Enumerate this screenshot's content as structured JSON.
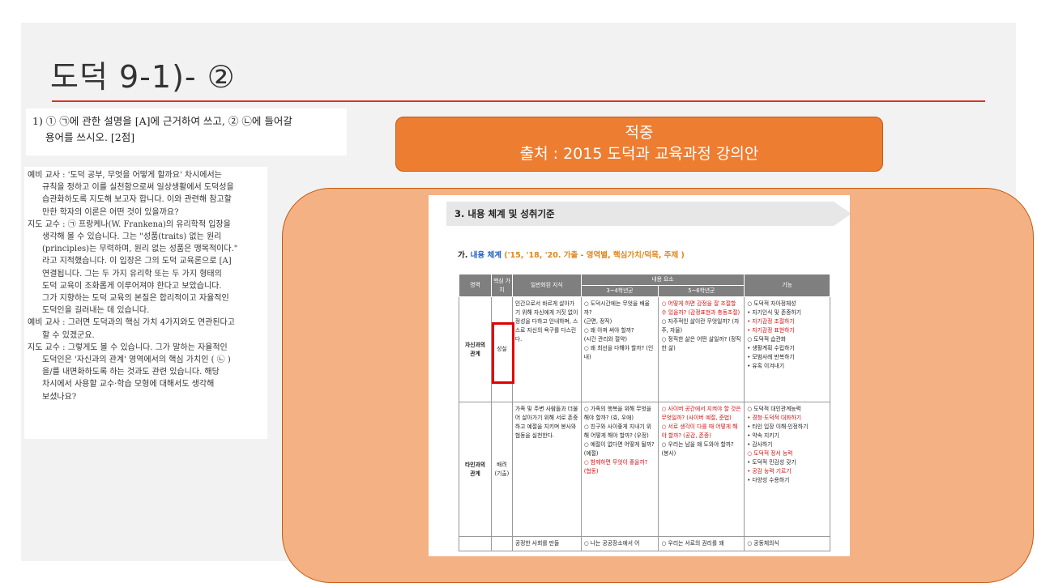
{
  "slide": {
    "title": "도덕 9-1)- ②"
  },
  "question": {
    "line1": "1) ① ㉠에 관한 설명을 [A]에 근거하여 쓰고, ② ㉡에 들어갈",
    "line2": "용어를 쓰시오. [2점]"
  },
  "dialog": {
    "lines": [
      "예비 교사 : '도덕 공부, 무엇을 어떻게 할까요' 차시에서는",
      "규칙을 정하고 이를 실천함으로써 일상생활에서 도덕성을",
      "습관화하도록 지도해 보고자 합니다. 이와 관련해 참고할",
      "만한 학자의 이론은 어떤 것이 있을까요?",
      "지도 교수 : ㉠ 프랑케나(W. Frankena)의 유리학적 입장을",
      "생각해 볼 수 있습니다. 그는 \"성품(traits) 없는 원리",
      "(principles)는 무력하며, 원리 없는 성품은 맹목적이다.\"",
      "라고 지적했습니다. 이 입장은 그의 도덕 교육론으로 [A]",
      "연결됩니다. 그는 두 가지 유리학 또는 두 가지 형태의",
      "도덕 교육이 조화롭게 이루어져야 한다고 보았습니다.",
      "그가 지향하는 도덕 교육의 본질은 합리적이고 자율적인",
      "도덕인을 길러내는 데 있습니다.",
      "예비 교사 : 그러면 도덕과의 핵심 가치 4가지와도 연관된다고",
      "할 수 있겠군요.",
      "지도 교수 : 그렇게도 볼 수 있습니다. 그가 말하는 자율적인",
      "도덕인은 '자신과의 관계' 영역에서의 핵심 가치인 (  ㉡  )",
      "을/를 내면화하도록 하는 것과도 관련 있습니다. 해당",
      "차시에서 사용할 교수·학습 모형에 대해서도 생각해",
      "보셨나요?"
    ]
  },
  "callout": {
    "line1": "적중",
    "line2": "출처 : 2015 도덕과 교육과정 강의안"
  },
  "doc": {
    "section_title": "3. 내용 체계 및 성취기준",
    "subheading_prefix": "가.",
    "subheading_main": "내용 체계",
    "subheading_suffix": "('15, '18, '20. 가출 - 영역별, 핵심가치/덕목, 주제 )",
    "table": {
      "headers": {
        "area": "영역",
        "core_value": "핵심 가치",
        "general_knowledge": "일반화된 지식",
        "content": "내용 요소",
        "grade34": "3~4학년군",
        "grade56": "5~6학년군",
        "function": "기능"
      },
      "rows": [
        {
          "area": "자신과의 관계",
          "value": "성실",
          "knowledge": "인간으로서 바르게 살아가기 위해 자신에게 거짓 없이 정성을 다하고 인내하며, 스스로 자신의 욕구를 다스린다.",
          "g34": [
            {
              "t": "○ 도덕시간에는 무엇을 배울까?",
              "red": false
            },
            {
              "t": "(근면, 정직)",
              "red": false
            },
            {
              "t": "○ 왜 아껴 써야 할까?",
              "red": false
            },
            {
              "t": "(시간 관리와 절약)",
              "red": false
            },
            {
              "t": "○ 왜 최선을 다해야 할까? (인내)",
              "red": false
            }
          ],
          "g56": [
            {
              "t": "○ 어떻게 하면 감정을 잘 조절할 수 있을까? (감정표현과 충동조절)",
              "red": true
            },
            {
              "t": "○ 자주적인 삶이란 무엇일까? (자주, 자율)",
              "red": false
            },
            {
              "t": "○ 정직한 삶은 어떤 삶일까? (정직한 삶)",
              "red": false
            }
          ],
          "func": [
            {
              "t": "○ 도덕적 자아정체성",
              "red": false
            },
            {
              "t": "• 자기인식 및 존중하기",
              "red": false
            },
            {
              "t": "• 자기감정 조절하기",
              "red": true
            },
            {
              "t": "• 자기감정 표현하기",
              "red": true
            },
            {
              "t": "○ 도덕적 습관화",
              "red": false
            },
            {
              "t": "• 생활계획 수립하기",
              "red": false
            },
            {
              "t": "• 모범사례 반복하기",
              "red": false
            },
            {
              "t": "• 유혹 이겨내기",
              "red": false
            }
          ]
        },
        {
          "area": "타인과의 관계",
          "value": "배려 (기출)",
          "knowledge": "가족 및 주변 사람들과 더불어 살아가기 위해 서로 존중하고 예절을 지키며 봉사와 협동을 실천한다.",
          "g34": [
            {
              "t": "○ 가족의 행복을 위해 무엇을 해야 할까? (효, 우애)",
              "red": false
            },
            {
              "t": "○ 친구와 사이좋게 지내기 위해 어떻게 해야 할까? (우정)",
              "red": false
            },
            {
              "t": "○ 예절이 없다면 어떻게 될까? (예절)",
              "red": false
            },
            {
              "t": "○ 함께하면 무엇이 좋을까? (협동)",
              "red": true
            }
          ],
          "g56": [
            {
              "t": "○ 사이버 공간에서 지켜야 할 것은 무엇일까? (사이버 예절, 준법)",
              "red": true
            },
            {
              "t": "○ 서로 생각이 다를 때 어떻게 해야 할까? (공감, 존중)",
              "red": true
            },
            {
              "t": "○ 우리는 남을 왜 도와야 할까? (봉사)",
              "red": false
            }
          ],
          "func": [
            {
              "t": "○ 도덕적 대인관계능력",
              "red": false
            },
            {
              "t": "• 경청·도덕적 대화하기",
              "red": true
            },
            {
              "t": "• 타인 입장 이해·인정하기",
              "red": false
            },
            {
              "t": "• 약속 지키기",
              "red": false
            },
            {
              "t": "• 감사하기",
              "red": false
            },
            {
              "t": "○ 도덕적 정서 능력",
              "red": true
            },
            {
              "t": "• 도덕적 민감성 갖기",
              "red": false
            },
            {
              "t": "• 공감 능력 기르기",
              "red": true
            },
            {
              "t": "• 다양성 수용하기",
              "red": false
            }
          ]
        }
      ],
      "partial_row": {
        "knowledge": "공정한 사회를 만들",
        "g34": "○ 나는 공공장소에서 어",
        "g56": "○ 우리는 서로의 권리를 왜",
        "func": "○ 공동체의식"
      }
    }
  },
  "colors": {
    "accent_rule": "#d9341e",
    "callout_fill": "#ed7d31",
    "peach_fill": "#f4b183",
    "highlight_box": "#e00000"
  }
}
